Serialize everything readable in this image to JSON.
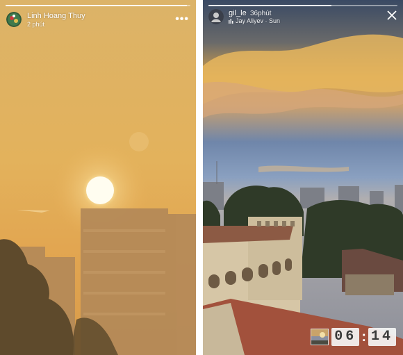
{
  "left_story": {
    "username": "Linh Hoang Thuy",
    "time": "2 phút",
    "progress": 0.98,
    "more_icon": "more-dots-icon",
    "avatar_icon": "avatar"
  },
  "right_story": {
    "username": "gil_le",
    "time": "36phút",
    "music": "Jay Aliyev · Sun",
    "music_icon": "music-bars-icon",
    "progress": 0.65,
    "close_icon": "close-icon",
    "timer": {
      "hours": "06",
      "minutes": "14"
    }
  }
}
